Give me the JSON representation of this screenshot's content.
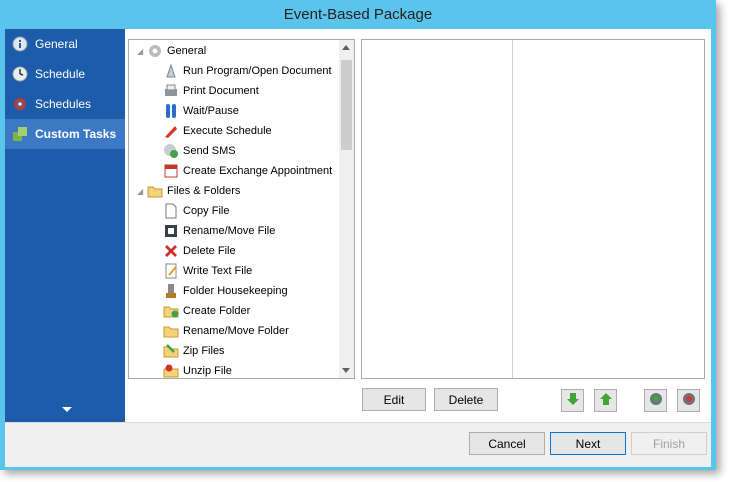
{
  "window": {
    "title": "Event-Based Package"
  },
  "sidebar": {
    "items": [
      {
        "label": "General",
        "icon": "info-icon"
      },
      {
        "label": "Schedule",
        "icon": "clock-icon"
      },
      {
        "label": "Schedules",
        "icon": "schedules-icon"
      },
      {
        "label": "Custom Tasks",
        "icon": "custom-tasks-icon",
        "active": true
      }
    ]
  },
  "tree": {
    "items": [
      {
        "label": "General",
        "type": "group",
        "icon": "gear-icon"
      },
      {
        "label": "Run Program/Open Document",
        "icon": "run-program-icon"
      },
      {
        "label": "Print Document",
        "icon": "printer-icon"
      },
      {
        "label": "Wait/Pause",
        "icon": "pause-icon"
      },
      {
        "label": "Execute Schedule",
        "icon": "execute-schedule-icon"
      },
      {
        "label": "Send SMS",
        "icon": "sms-icon"
      },
      {
        "label": "Create Exchange Appointment",
        "icon": "calendar-icon"
      },
      {
        "label": "Files & Folders",
        "type": "group",
        "icon": "folder-icon"
      },
      {
        "label": "Copy File",
        "icon": "copy-file-icon"
      },
      {
        "label": "Rename/Move File",
        "icon": "rename-file-icon"
      },
      {
        "label": "Delete File",
        "icon": "delete-icon"
      },
      {
        "label": "Write Text File",
        "icon": "write-file-icon"
      },
      {
        "label": "Folder Housekeeping",
        "icon": "housekeeping-icon"
      },
      {
        "label": "Create Folder",
        "icon": "create-folder-icon"
      },
      {
        "label": "Rename/Move Folder",
        "icon": "rename-folder-icon"
      },
      {
        "label": "Zip Files",
        "icon": "zip-icon"
      },
      {
        "label": "Unzip File",
        "icon": "unzip-icon"
      }
    ]
  },
  "actions": {
    "edit": "Edit",
    "delete": "Delete"
  },
  "footer": {
    "cancel": "Cancel",
    "next": "Next",
    "finish": "Finish"
  },
  "colors": {
    "titlebar": "#5bc4ec",
    "sidebar": "#1d5bab",
    "sidebar_active": "#3b79c4"
  }
}
